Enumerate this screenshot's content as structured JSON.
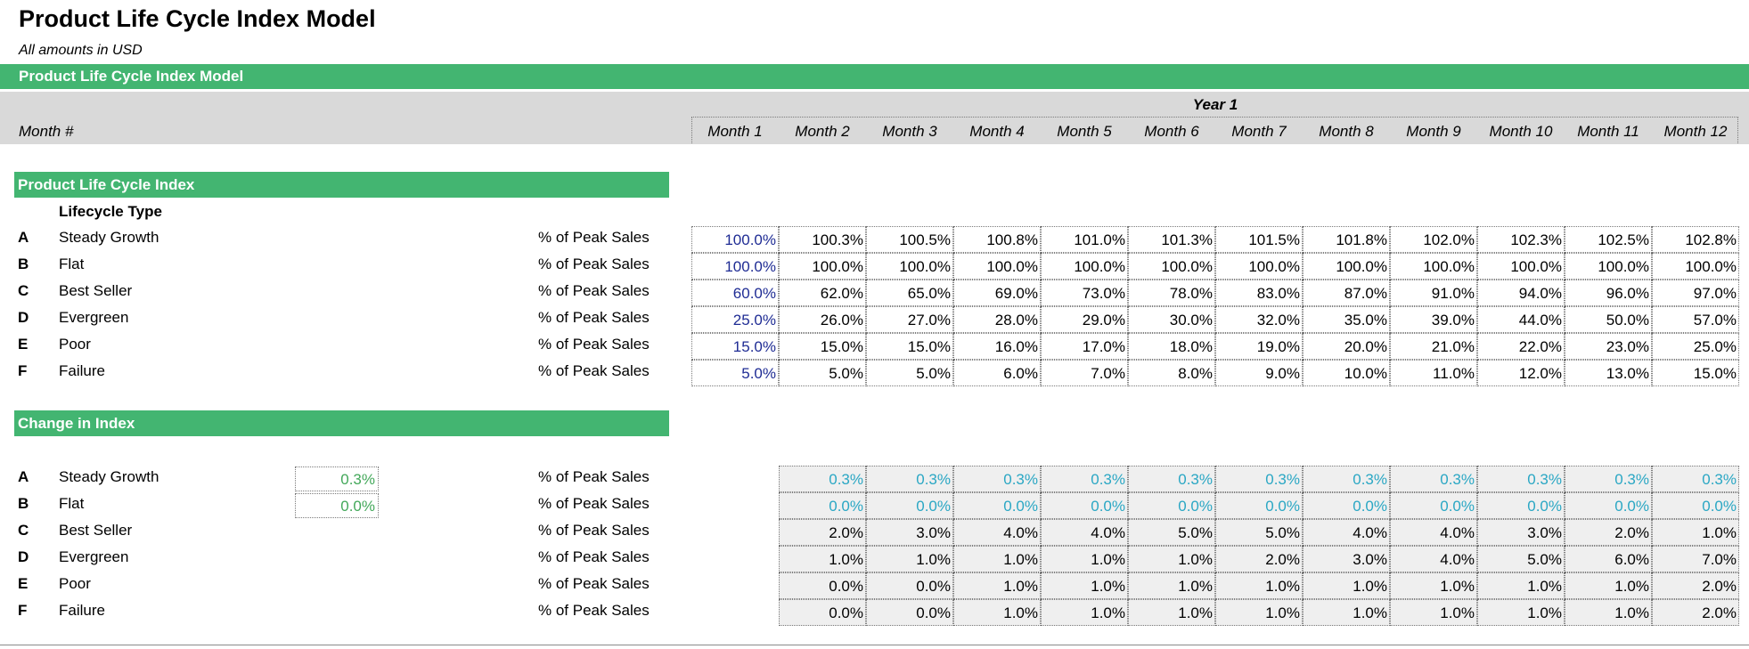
{
  "title": "Product Life Cycle Index Model",
  "subtitle": "All amounts in  USD",
  "main_header": "Product Life Cycle Index Model",
  "year_label": "Year 1",
  "month_label": "Month #",
  "months": [
    "Month 1",
    "Month 2",
    "Month 3",
    "Month 4",
    "Month 5",
    "Month 6",
    "Month 7",
    "Month 8",
    "Month 9",
    "Month 10",
    "Month 11",
    "Month 12"
  ],
  "index_section": {
    "heading": "Product Life Cycle Index",
    "subheading": "Lifecycle Type",
    "rows": [
      {
        "letter": "A",
        "name": "Steady Growth",
        "unit": "% of Peak Sales",
        "values": [
          "100.0%",
          "100.3%",
          "100.5%",
          "100.8%",
          "101.0%",
          "101.3%",
          "101.5%",
          "101.8%",
          "102.0%",
          "102.3%",
          "102.5%",
          "102.8%"
        ]
      },
      {
        "letter": "B",
        "name": "Flat",
        "unit": "% of Peak Sales",
        "values": [
          "100.0%",
          "100.0%",
          "100.0%",
          "100.0%",
          "100.0%",
          "100.0%",
          "100.0%",
          "100.0%",
          "100.0%",
          "100.0%",
          "100.0%",
          "100.0%"
        ]
      },
      {
        "letter": "C",
        "name": "Best Seller",
        "unit": "% of Peak Sales",
        "values": [
          "60.0%",
          "62.0%",
          "65.0%",
          "69.0%",
          "73.0%",
          "78.0%",
          "83.0%",
          "87.0%",
          "91.0%",
          "94.0%",
          "96.0%",
          "97.0%"
        ]
      },
      {
        "letter": "D",
        "name": "Evergreen",
        "unit": "% of Peak Sales",
        "values": [
          "25.0%",
          "26.0%",
          "27.0%",
          "28.0%",
          "29.0%",
          "30.0%",
          "32.0%",
          "35.0%",
          "39.0%",
          "44.0%",
          "50.0%",
          "57.0%"
        ]
      },
      {
        "letter": "E",
        "name": "Poor",
        "unit": "% of Peak Sales",
        "values": [
          "15.0%",
          "15.0%",
          "15.0%",
          "16.0%",
          "17.0%",
          "18.0%",
          "19.0%",
          "20.0%",
          "21.0%",
          "22.0%",
          "23.0%",
          "25.0%"
        ]
      },
      {
        "letter": "F",
        "name": "Failure",
        "unit": "% of Peak Sales",
        "values": [
          "5.0%",
          "5.0%",
          "5.0%",
          "6.0%",
          "7.0%",
          "8.0%",
          "9.0%",
          "10.0%",
          "11.0%",
          "12.0%",
          "13.0%",
          "15.0%"
        ]
      }
    ]
  },
  "change_section": {
    "heading": "Change in Index",
    "rows": [
      {
        "letter": "A",
        "name": "Steady Growth",
        "unit": "% of Peak Sales",
        "driver": "0.3%",
        "values": [
          "0.3%",
          "0.3%",
          "0.3%",
          "0.3%",
          "0.3%",
          "0.3%",
          "0.3%",
          "0.3%",
          "0.3%",
          "0.3%",
          "0.3%"
        ]
      },
      {
        "letter": "B",
        "name": "Flat",
        "unit": "% of Peak Sales",
        "driver": "0.0%",
        "values": [
          "0.0%",
          "0.0%",
          "0.0%",
          "0.0%",
          "0.0%",
          "0.0%",
          "0.0%",
          "0.0%",
          "0.0%",
          "0.0%",
          "0.0%"
        ]
      },
      {
        "letter": "C",
        "name": "Best Seller",
        "unit": "% of Peak Sales",
        "driver": null,
        "values": [
          "2.0%",
          "3.0%",
          "4.0%",
          "4.0%",
          "5.0%",
          "5.0%",
          "4.0%",
          "4.0%",
          "3.0%",
          "2.0%",
          "1.0%"
        ]
      },
      {
        "letter": "D",
        "name": "Evergreen",
        "unit": "% of Peak Sales",
        "driver": null,
        "values": [
          "1.0%",
          "1.0%",
          "1.0%",
          "1.0%",
          "1.0%",
          "2.0%",
          "3.0%",
          "4.0%",
          "5.0%",
          "6.0%",
          "7.0%"
        ]
      },
      {
        "letter": "E",
        "name": "Poor",
        "unit": "% of Peak Sales",
        "driver": null,
        "values": [
          "0.0%",
          "0.0%",
          "1.0%",
          "1.0%",
          "1.0%",
          "1.0%",
          "1.0%",
          "1.0%",
          "1.0%",
          "1.0%",
          "2.0%"
        ]
      },
      {
        "letter": "F",
        "name": "Failure",
        "unit": "% of Peak Sales",
        "driver": null,
        "values": [
          "0.0%",
          "0.0%",
          "1.0%",
          "1.0%",
          "1.0%",
          "1.0%",
          "1.0%",
          "1.0%",
          "1.0%",
          "1.0%",
          "2.0%"
        ]
      }
    ]
  },
  "colors": {
    "accent_green": "#43b571",
    "input_blue": "#1f2c94",
    "change_cyan": "#2aa7c4",
    "driver_green": "#43a85a",
    "header_gray": "#d9d9d9",
    "change_cell_bg": "#efefef"
  }
}
